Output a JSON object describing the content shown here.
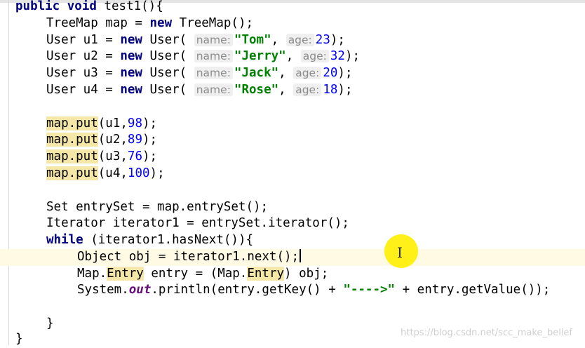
{
  "editor": {
    "lines": [
      {
        "tokens": [
          {
            "t": "kw",
            "v": "public"
          },
          {
            "t": "txt",
            "v": " "
          },
          {
            "t": "kw",
            "v": "void"
          },
          {
            "t": "txt",
            "v": " test1(){"
          }
        ]
      },
      {
        "tokens": [
          {
            "t": "txt",
            "v": "TreeMap map = "
          },
          {
            "t": "kw",
            "v": "new"
          },
          {
            "t": "txt",
            "v": " TreeMap();"
          }
        ]
      },
      {
        "tokens": [
          {
            "t": "txt",
            "v": "User u1 = "
          },
          {
            "t": "kw",
            "v": "new"
          },
          {
            "t": "txt",
            "v": " User( "
          },
          {
            "t": "hint",
            "v": "name:"
          },
          {
            "t": "str",
            "v": "\"Tom\""
          },
          {
            "t": "txt",
            "v": ", "
          },
          {
            "t": "hint",
            "v": "age:"
          },
          {
            "t": "num",
            "v": "23"
          },
          {
            "t": "txt",
            "v": ");"
          }
        ]
      },
      {
        "tokens": [
          {
            "t": "txt",
            "v": "User u2 = "
          },
          {
            "t": "kw",
            "v": "new"
          },
          {
            "t": "txt",
            "v": " User( "
          },
          {
            "t": "hint",
            "v": "name:"
          },
          {
            "t": "str",
            "v": "\"Jerry\""
          },
          {
            "t": "txt",
            "v": ", "
          },
          {
            "t": "hint",
            "v": "age:"
          },
          {
            "t": "num",
            "v": "32"
          },
          {
            "t": "txt",
            "v": ");"
          }
        ]
      },
      {
        "tokens": [
          {
            "t": "txt",
            "v": "User u3 = "
          },
          {
            "t": "kw",
            "v": "new"
          },
          {
            "t": "txt",
            "v": " User( "
          },
          {
            "t": "hint",
            "v": "name:"
          },
          {
            "t": "str",
            "v": "\"Jack\""
          },
          {
            "t": "txt",
            "v": ", "
          },
          {
            "t": "hint",
            "v": "age:"
          },
          {
            "t": "num",
            "v": "20"
          },
          {
            "t": "txt",
            "v": ");"
          }
        ]
      },
      {
        "tokens": [
          {
            "t": "txt",
            "v": "User u4 = "
          },
          {
            "t": "kw",
            "v": "new"
          },
          {
            "t": "txt",
            "v": " User( "
          },
          {
            "t": "hint",
            "v": "name:"
          },
          {
            "t": "str",
            "v": "\"Rose\""
          },
          {
            "t": "txt",
            "v": ", "
          },
          {
            "t": "hint",
            "v": "age:"
          },
          {
            "t": "num",
            "v": "18"
          },
          {
            "t": "txt",
            "v": ");"
          }
        ]
      },
      {
        "tokens": []
      },
      {
        "tokens": [
          {
            "t": "mark",
            "v": "map.put"
          },
          {
            "t": "txt",
            "v": "(u1,"
          },
          {
            "t": "num",
            "v": "98"
          },
          {
            "t": "txt",
            "v": ");"
          }
        ]
      },
      {
        "tokens": [
          {
            "t": "mark",
            "v": "map.put"
          },
          {
            "t": "txt",
            "v": "(u2,"
          },
          {
            "t": "num",
            "v": "89"
          },
          {
            "t": "txt",
            "v": ");"
          }
        ]
      },
      {
        "tokens": [
          {
            "t": "mark",
            "v": "map.put"
          },
          {
            "t": "txt",
            "v": "(u3,"
          },
          {
            "t": "num",
            "v": "76"
          },
          {
            "t": "txt",
            "v": ");"
          }
        ]
      },
      {
        "tokens": [
          {
            "t": "mark",
            "v": "map.put"
          },
          {
            "t": "txt",
            "v": "(u4,"
          },
          {
            "t": "num",
            "v": "100"
          },
          {
            "t": "txt",
            "v": ");"
          }
        ]
      },
      {
        "tokens": []
      },
      {
        "tokens": [
          {
            "t": "txt",
            "v": "Set entrySet = map.entrySet();"
          }
        ]
      },
      {
        "tokens": [
          {
            "t": "txt",
            "v": "Iterator iterator1 = entrySet.iterator();"
          }
        ]
      },
      {
        "tokens": [
          {
            "t": "kw",
            "v": "while"
          },
          {
            "t": "txt",
            "v": " (iterator1.hasNext()){"
          }
        ]
      },
      {
        "tokens": [
          {
            "t": "txt",
            "v": "Object obj = iterator1.next();"
          },
          {
            "t": "caret",
            "v": ""
          }
        ]
      },
      {
        "tokens": [
          {
            "t": "txt",
            "v": "Map."
          },
          {
            "t": "mark",
            "v": "Entry"
          },
          {
            "t": "txt",
            "v": " entry = (Map."
          },
          {
            "t": "mark",
            "v": "Entry"
          },
          {
            "t": "txt",
            "v": ") obj;"
          }
        ]
      },
      {
        "tokens": [
          {
            "t": "txt",
            "v": "System."
          },
          {
            "t": "static",
            "v": "out"
          },
          {
            "t": "txt",
            "v": ".println(entry.getKey() + "
          },
          {
            "t": "str",
            "v": "\"---->\""
          },
          {
            "t": "txt",
            "v": " + entry.getValue());"
          }
        ]
      },
      {
        "tokens": []
      },
      {
        "tokens": [
          {
            "t": "txt",
            "v": "}"
          }
        ]
      },
      {
        "tokens": [
          {
            "t": "txt",
            "v": "}"
          }
        ]
      }
    ]
  },
  "watermark": "https://blog.csdn.net/scc_make_belief",
  "colors": {
    "keyword": "#000080",
    "string": "#008000",
    "number": "#0000ff",
    "hint_background": "#efefef",
    "usage_highlight": "#f5e7a8",
    "current_line": "#fffae3",
    "cursor_highlight": "#ffee00"
  }
}
